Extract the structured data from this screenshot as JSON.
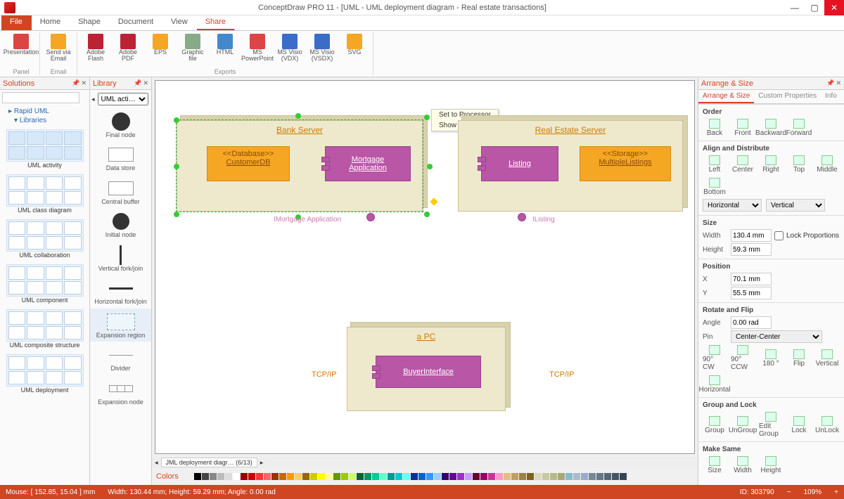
{
  "app_title": "ConceptDraw PRO 11 - [UML - UML deployment diagram - Real estate transactions]",
  "menu": {
    "file": "File",
    "tabs": [
      "Home",
      "Shape",
      "Document",
      "View",
      "Share"
    ],
    "active": "Share"
  },
  "ribbon": {
    "groups": [
      {
        "label": "Panel",
        "items": [
          {
            "label": "Presentation",
            "color": "#d44"
          }
        ]
      },
      {
        "label": "Email",
        "items": [
          {
            "label": "Send via Email",
            "color": "#f5a623"
          }
        ]
      },
      {
        "label": "Exports",
        "items": [
          {
            "label": "Adobe Flash",
            "color": "#b23"
          },
          {
            "label": "Adobe PDF",
            "color": "#b23"
          },
          {
            "label": "EPS",
            "color": "#f5a623"
          },
          {
            "label": "Graphic file",
            "color": "#8a8"
          },
          {
            "label": "HTML",
            "color": "#48c"
          },
          {
            "label": "MS PowerPoint",
            "color": "#d44"
          },
          {
            "label": "MS Visio (VDX)",
            "color": "#3a6cc8"
          },
          {
            "label": "MS Visio (VSDX)",
            "color": "#3a6cc8"
          },
          {
            "label": "SVG",
            "color": "#f5a623"
          }
        ]
      }
    ]
  },
  "solutions": {
    "title": "Solutions",
    "tree": {
      "root": "Rapid UML",
      "child": "Libraries"
    },
    "cats": [
      "UML activity",
      "UML class diagram",
      "UML collaboration",
      "UML component",
      "UML composite structure",
      "UML deployment"
    ],
    "selected": "UML activity"
  },
  "library": {
    "title": "Library",
    "selector": "UML acti…",
    "items": [
      "Final node",
      "Data store",
      "Central buffer",
      "Initial node",
      "Vertical fork/join",
      "Horizontal fork/join",
      "Expansion region",
      "Divider",
      "Expansion node"
    ],
    "selected": "Expansion region"
  },
  "canvas": {
    "popup": [
      "Set to Processor",
      "Show Label"
    ],
    "bank": {
      "title": "Bank Server",
      "db": {
        "stereo": "<<Database>>",
        "name": "CustomerDB"
      },
      "comp": {
        "line1": "Mortgage",
        "line2": "Application"
      },
      "iface": "IMortgage Application"
    },
    "realestate": {
      "title": "Real Estate Server",
      "comp": "Listing",
      "store": {
        "stereo": "<<Storage>>",
        "name": "MultipleListings"
      },
      "iface": "IListing"
    },
    "pc": {
      "title": "a PC",
      "comp": "BuyerInterface"
    },
    "conn": {
      "left": "TCP/IP",
      "right": "TCP/IP"
    },
    "doc_tab": "JML deployment diagr… (6/13)"
  },
  "colors_label": "Colors",
  "right": {
    "title": "Arrange & Size",
    "tabs": [
      "Arrange & Size",
      "Custom Properties",
      "Info"
    ],
    "order": {
      "head": "Order",
      "btns": [
        "Back",
        "Front",
        "Backward",
        "Forward"
      ]
    },
    "align": {
      "head": "Align and Distribute",
      "btns": [
        "Left",
        "Center",
        "Right",
        "Top",
        "Middle",
        "Bottom"
      ],
      "sel1": "Horizontal",
      "sel2": "Vertical"
    },
    "size": {
      "head": "Size",
      "width_l": "Width",
      "width_v": "130.4 mm",
      "height_l": "Height",
      "height_v": "59.3 mm",
      "lock": "Lock Proportions"
    },
    "pos": {
      "head": "Position",
      "x_l": "X",
      "x_v": "70.1 mm",
      "y_l": "Y",
      "y_v": "55.5 mm"
    },
    "rot": {
      "head": "Rotate and Flip",
      "angle_l": "Angle",
      "angle_v": "0.00 rad",
      "pin_l": "Pin",
      "pin_v": "Center-Center",
      "btns": [
        "90° CW",
        "90° CCW",
        "180 °",
        "Flip",
        "Vertical",
        "Horizontal"
      ]
    },
    "group": {
      "head": "Group and Lock",
      "btns": [
        "Group",
        "UnGroup",
        "Edit Group",
        "Lock",
        "UnLock"
      ]
    },
    "make": {
      "head": "Make Same",
      "btns": [
        "Size",
        "Width",
        "Height"
      ]
    }
  },
  "status": {
    "mouse": "Mouse: [ 152.85, 15.04 ] mm",
    "dims": "Width: 130.44 mm;  Height: 59.29 mm;  Angle: 0.00 rad",
    "id": "ID: 303790",
    "zoom": "109%"
  },
  "swatch_colors": [
    "#000",
    "#444",
    "#888",
    "#bbb",
    "#ddd",
    "#fff",
    "#900",
    "#c00",
    "#f33",
    "#f66",
    "#930",
    "#c60",
    "#f90",
    "#fc6",
    "#960",
    "#cc0",
    "#ff0",
    "#ff9",
    "#690",
    "#9c0",
    "#cf6",
    "#063",
    "#096",
    "#0c9",
    "#6fc",
    "#099",
    "#0cc",
    "#6ff",
    "#039",
    "#06c",
    "#39f",
    "#9cf",
    "#306",
    "#609",
    "#93c",
    "#c9f",
    "#603",
    "#906",
    "#c39",
    "#f9c",
    "#e0c080",
    "#c0a060",
    "#a08040",
    "#806020",
    "#d8d8c0",
    "#c8c8a0",
    "#b8b890",
    "#a8a878",
    "#8bc",
    "#abc",
    "#9ac",
    "#789",
    "#678",
    "#567",
    "#456",
    "#345"
  ]
}
